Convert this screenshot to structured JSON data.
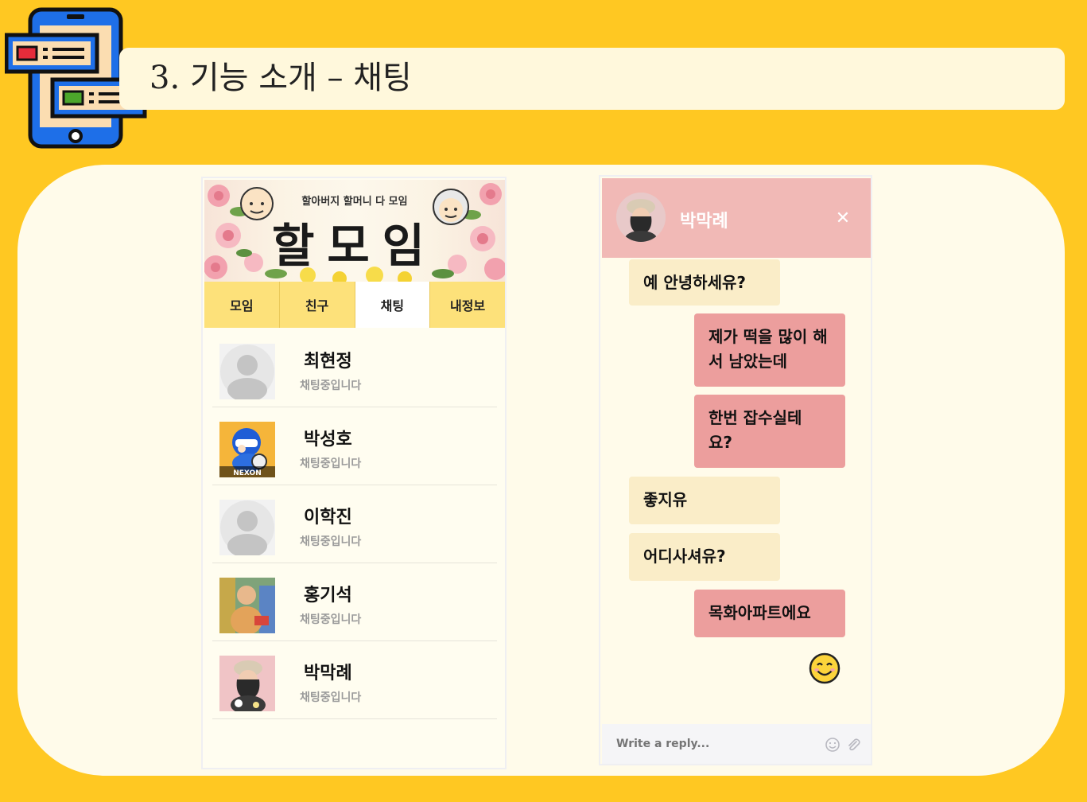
{
  "header": {
    "title": "3. 기능 소개 – 채팅"
  },
  "left_app": {
    "banner": {
      "subtitle": "할아버지 할머니 다 모임",
      "title": "할모임"
    },
    "tabs": [
      {
        "label": "모임",
        "active": false
      },
      {
        "label": "친구",
        "active": false
      },
      {
        "label": "채팅",
        "active": true
      },
      {
        "label": "내정보",
        "active": false
      }
    ],
    "chats": [
      {
        "name": "최현정",
        "status": "채팅중입니다",
        "avatar": "default-avatar"
      },
      {
        "name": "박성호",
        "status": "채팅중입니다",
        "avatar": "game-character",
        "avatar_caption": "NEXON"
      },
      {
        "name": "이학진",
        "status": "채팅중입니다",
        "avatar": "default-avatar"
      },
      {
        "name": "홍기석",
        "status": "채팅중입니다",
        "avatar": "photo"
      },
      {
        "name": "박막례",
        "status": "채팅중입니다",
        "avatar": "photo"
      }
    ]
  },
  "right_app": {
    "contact_name": "박막례",
    "close_icon": "close-icon",
    "messages": [
      {
        "direction": "in",
        "text": "예 안녕하세유?"
      },
      {
        "direction": "out",
        "text": "제가 떡을 많이 해서 남았는데"
      },
      {
        "direction": "out",
        "text": "한번 잡수실테 요?"
      },
      {
        "direction": "in",
        "text": "좋지유"
      },
      {
        "direction": "in",
        "text": "어디사셔유?"
      },
      {
        "direction": "out",
        "text": "목화아파트에요"
      },
      {
        "direction": "out",
        "emoji": "smiling-face"
      }
    ],
    "reply_placeholder": "Write a reply...",
    "reply_icons": [
      "emoji-icon",
      "attachment-icon"
    ]
  },
  "colors": {
    "background": "#FFC822",
    "panel": "#FFFBEA",
    "tab": "#FDE17A",
    "header_pink": "#F1B9B6",
    "bubble_in": "#FAEDC8",
    "bubble_out": "#EC9E9D"
  }
}
